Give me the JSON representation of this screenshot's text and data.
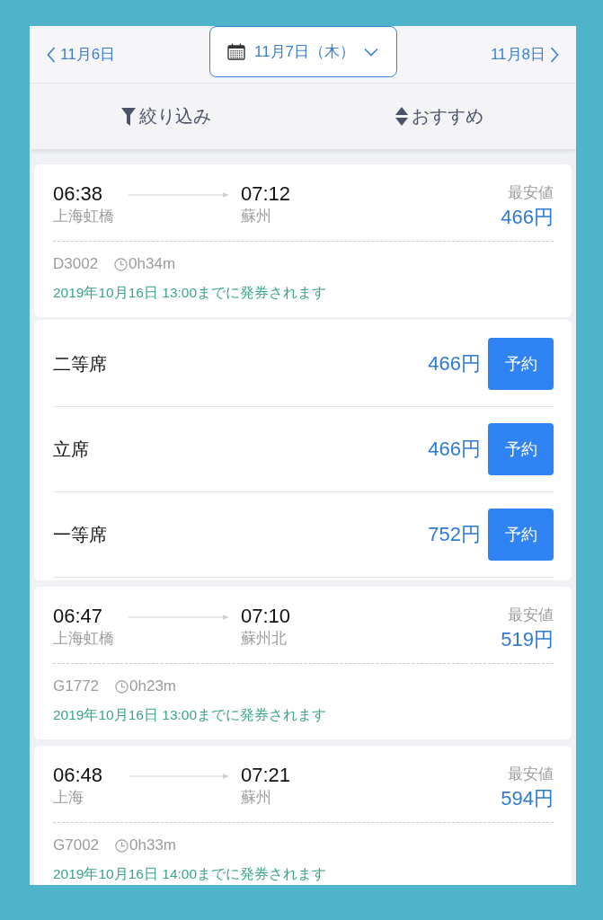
{
  "date_nav": {
    "previous": "11月6日",
    "current": "11月7日（木）",
    "next": "11月8日"
  },
  "toolbar": [
    {
      "kind": "filter",
      "label": "絞り込み"
    },
    {
      "kind": "sort",
      "label": "おすすめ"
    }
  ],
  "trains": [
    {
      "departure_time": "06:38",
      "departure_station": "上海虹橋",
      "arrival_time": "07:12",
      "arrival_station": "蘇州",
      "price_label": "最安値",
      "price": "466円",
      "number": "D3002",
      "duration": "0h34m",
      "ticketing_note": "2019年10月16日 13:00までに発券されます",
      "seats": [
        {
          "name": "二等席",
          "price": "466円",
          "action": "予約"
        },
        {
          "name": "立席",
          "price": "466円",
          "action": "予約"
        },
        {
          "name": "一等席",
          "price": "752円",
          "action": "予約"
        }
      ]
    },
    {
      "departure_time": "06:47",
      "departure_station": "上海虹橋",
      "arrival_time": "07:10",
      "arrival_station": "蘇州北",
      "price_label": "最安値",
      "price": "519円",
      "number": "G1772",
      "duration": "0h23m",
      "ticketing_note": "2019年10月16日 13:00までに発券されます"
    },
    {
      "departure_time": "06:48",
      "departure_station": "上海",
      "arrival_time": "07:21",
      "arrival_station": "蘇州",
      "price_label": "最安値",
      "price": "594円",
      "number": "G7002",
      "duration": "0h33m",
      "ticketing_note": "2019年10月16日 14:00までに発券されます"
    }
  ]
}
